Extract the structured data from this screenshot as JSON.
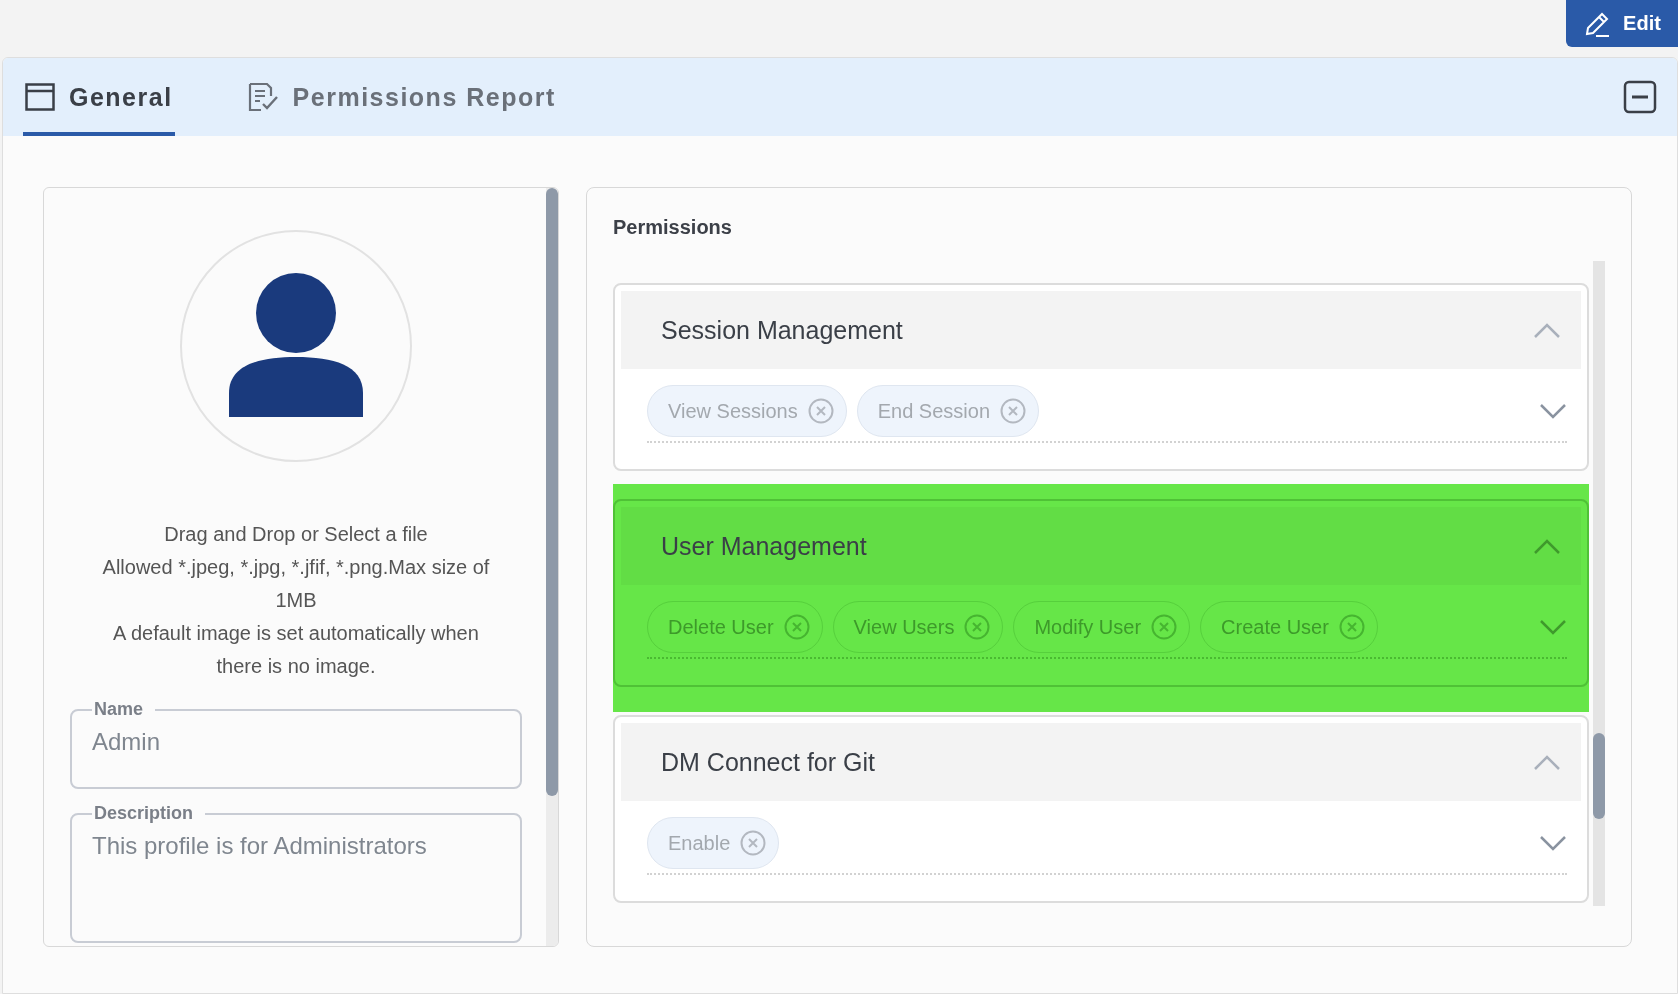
{
  "toolbar": {
    "edit_button": "Edit"
  },
  "tabs": [
    {
      "label": "General",
      "selected": true,
      "kind": "general"
    },
    {
      "label": "Permissions Report",
      "selected": false,
      "kind": "report"
    }
  ],
  "profile": {
    "upload_hint": [
      "Drag and Drop or Select a file",
      "Allowed *.jpeg, *.jpg, *.jfif, *.png.Max size of 1MB",
      "A default image is set automatically when there is no image."
    ],
    "name": {
      "label": "Name",
      "value": "Admin"
    },
    "description": {
      "label": "Description",
      "value": "This profile is for Administrators"
    }
  },
  "permissions": {
    "title": "Permissions",
    "groups": [
      {
        "name": "Session Management",
        "expanded": true,
        "highlighted": false,
        "tags": [
          "View Sessions",
          "End Session"
        ]
      },
      {
        "name": "User Management",
        "expanded": true,
        "highlighted": true,
        "tags": [
          "Delete User",
          "View Users",
          "Modify User",
          "Create User"
        ]
      },
      {
        "name": "DM Connect for Git",
        "expanded": true,
        "highlighted": false,
        "tags": [
          "Enable"
        ]
      }
    ]
  }
}
